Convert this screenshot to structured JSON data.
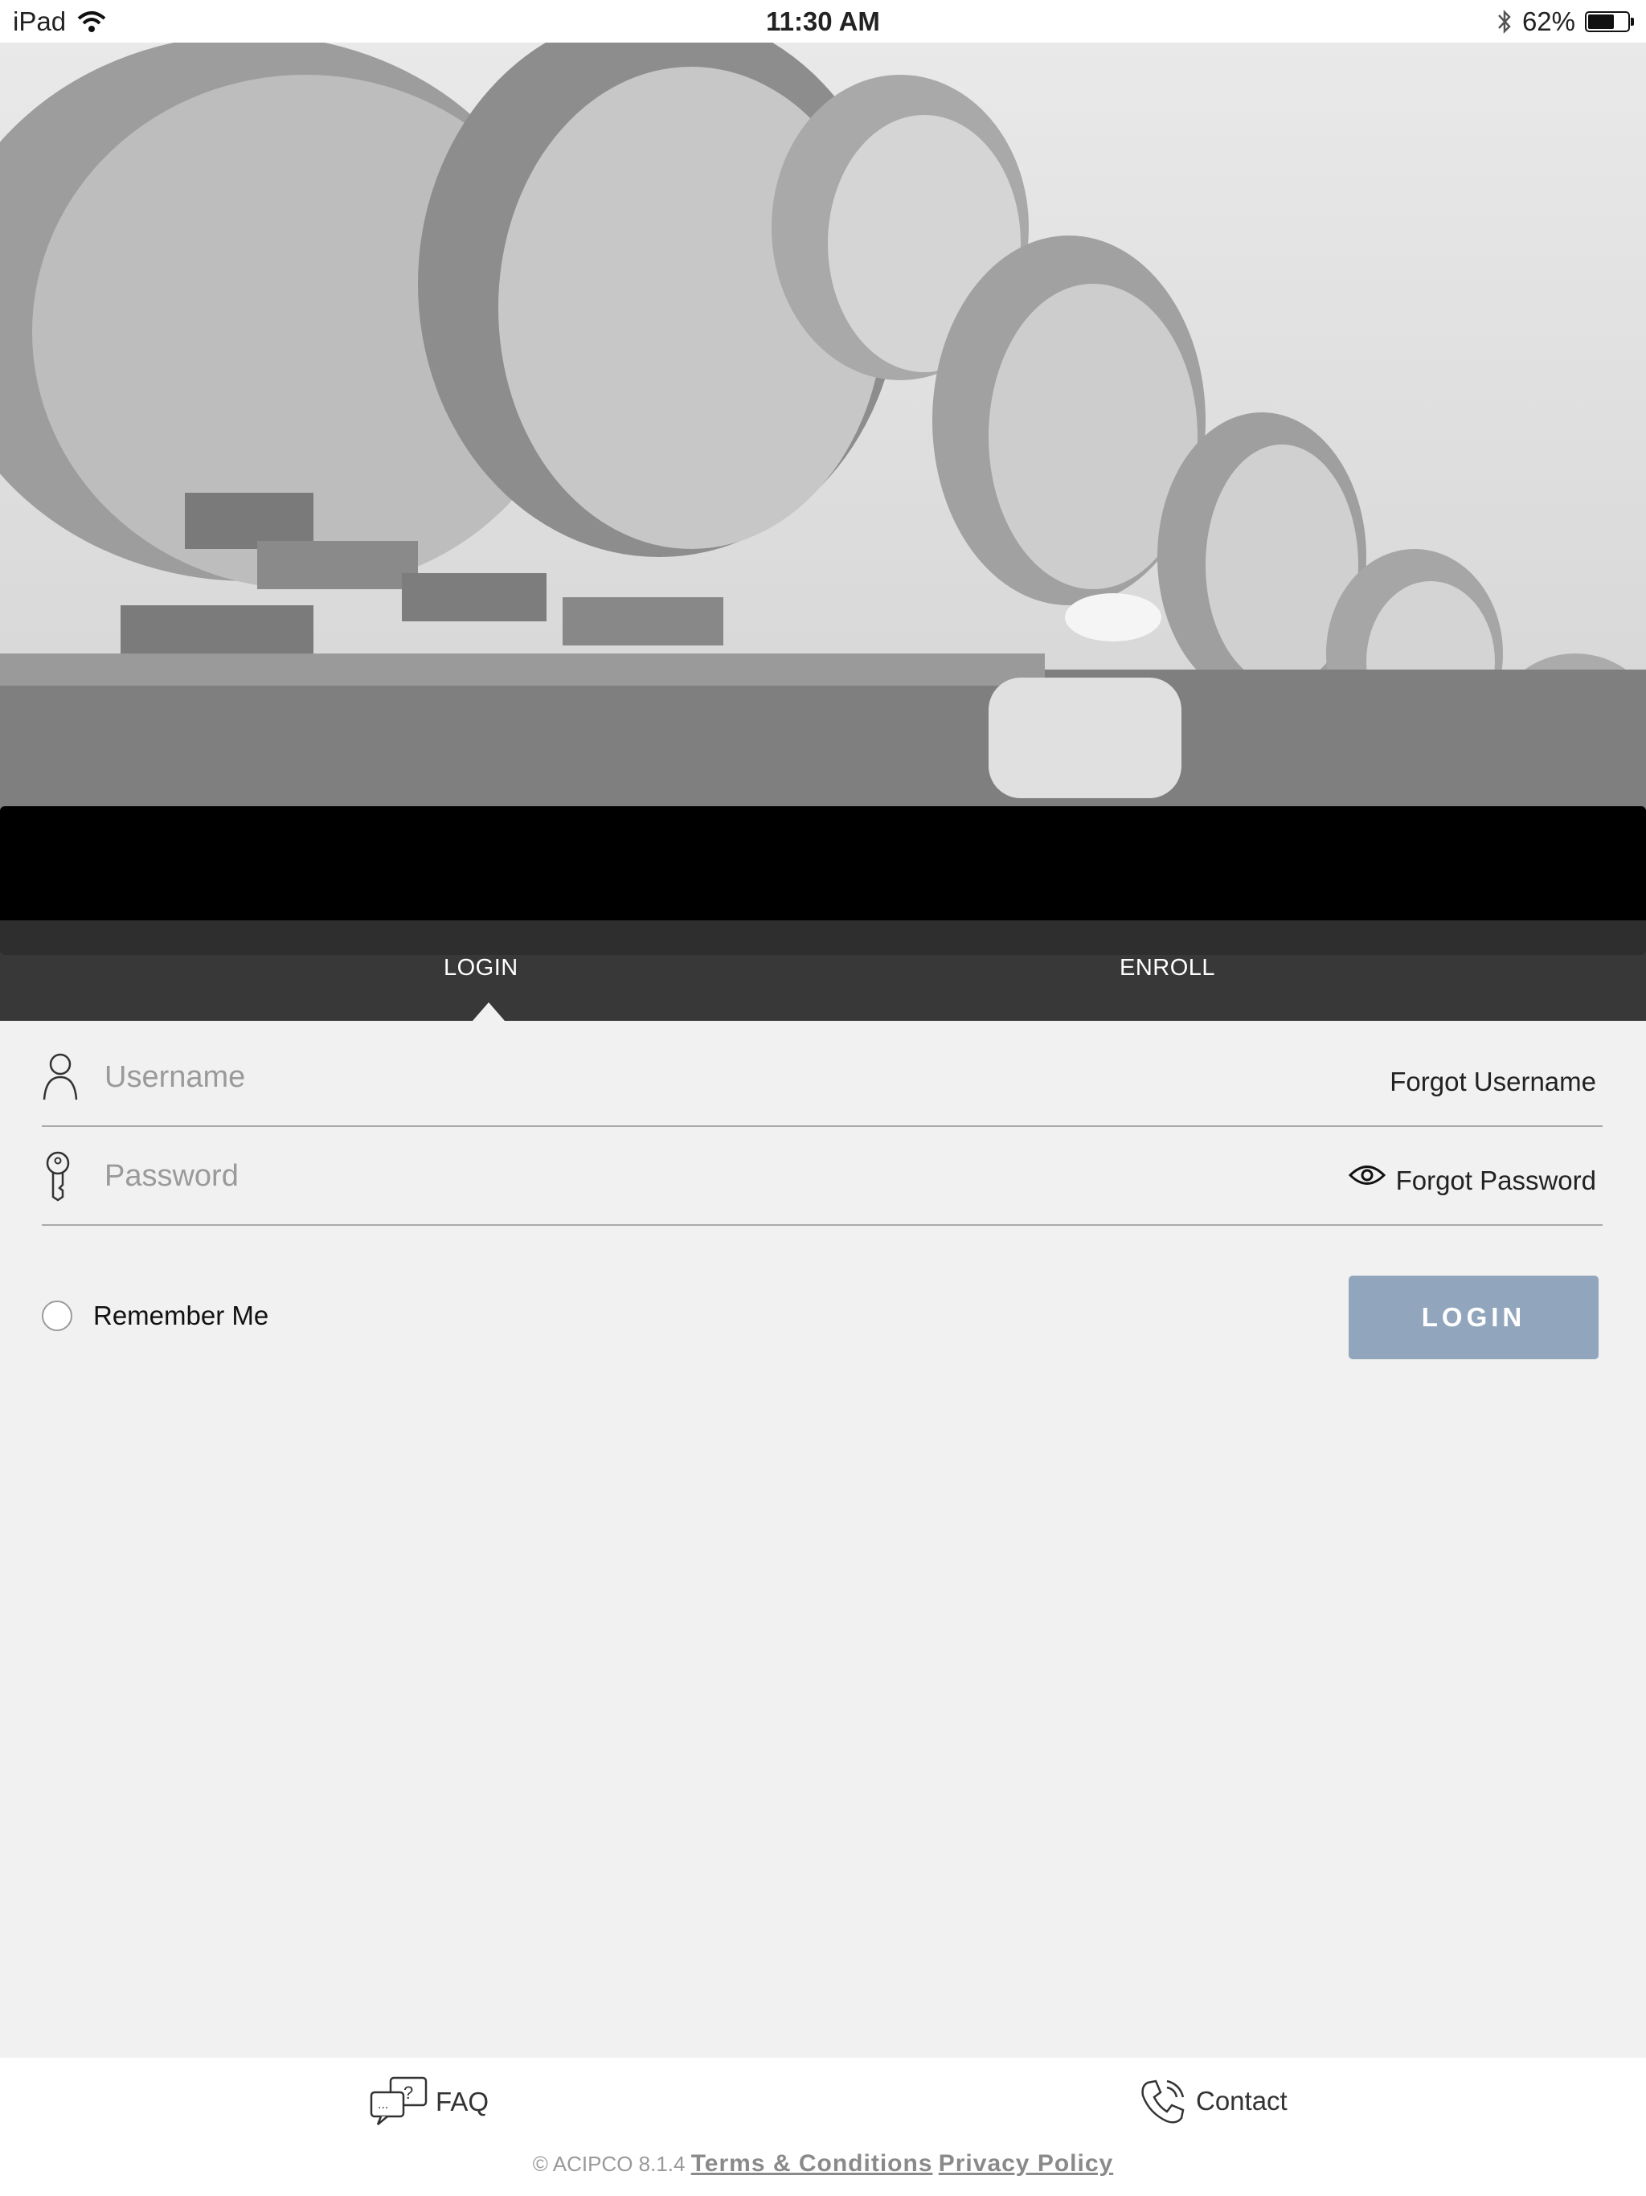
{
  "status_bar": {
    "device": "iPad",
    "time": "11:30 AM",
    "battery": "62%",
    "battery_level": 0.62
  },
  "tabs": [
    {
      "label": "LOGIN",
      "active": true
    },
    {
      "label": "ENROLL",
      "active": false
    }
  ],
  "form": {
    "username_placeholder": "Username",
    "password_placeholder": "Password",
    "forgot_username": "Forgot Username",
    "forgot_password": "Forgot Password",
    "remember_me": "Remember Me",
    "login_button": "LOGIN"
  },
  "footer": {
    "faq": "FAQ",
    "contact": "Contact",
    "copyright": "© ACIPCO 8.1.4",
    "terms": "Terms & Conditions",
    "privacy": "Privacy Policy"
  },
  "colors": {
    "login_button": "#91a6bd",
    "tab_band": "#323232",
    "page_bg": "#f0f1f0"
  },
  "icons": [
    "wifi-icon",
    "bluetooth-icon",
    "battery-icon",
    "user-icon",
    "key-icon",
    "eye-icon",
    "faq-icon",
    "phone-icon"
  ]
}
